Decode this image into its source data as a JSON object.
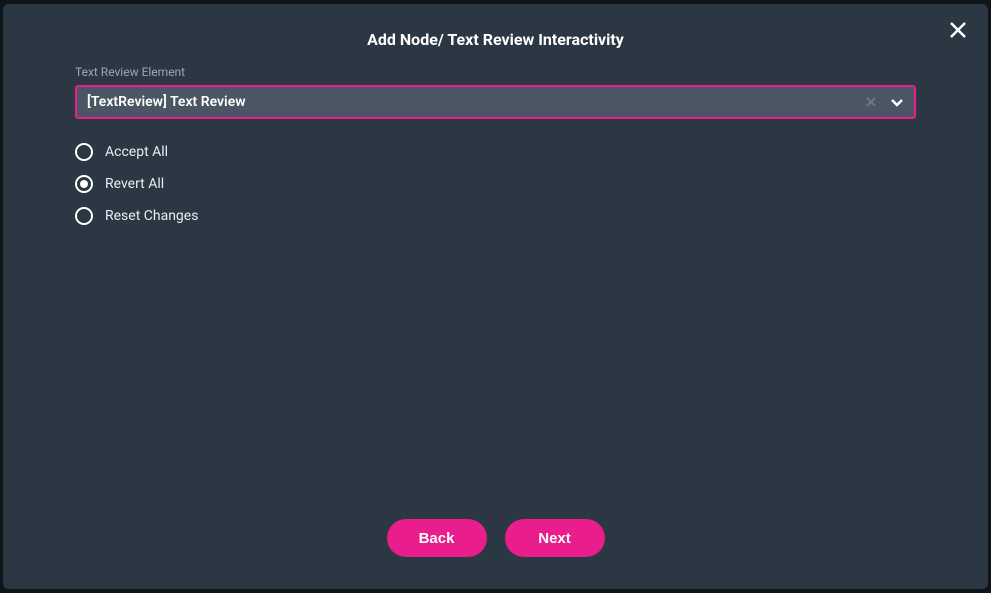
{
  "dialog": {
    "title": "Add Node/ Text Review Interactivity"
  },
  "field": {
    "label": "Text Review Element",
    "selected": "[TextReview] Text Review"
  },
  "options": [
    {
      "label": "Accept All",
      "selected": false
    },
    {
      "label": "Revert All",
      "selected": true
    },
    {
      "label": "Reset Changes",
      "selected": false
    }
  ],
  "buttons": {
    "back": "Back",
    "next": "Next"
  }
}
